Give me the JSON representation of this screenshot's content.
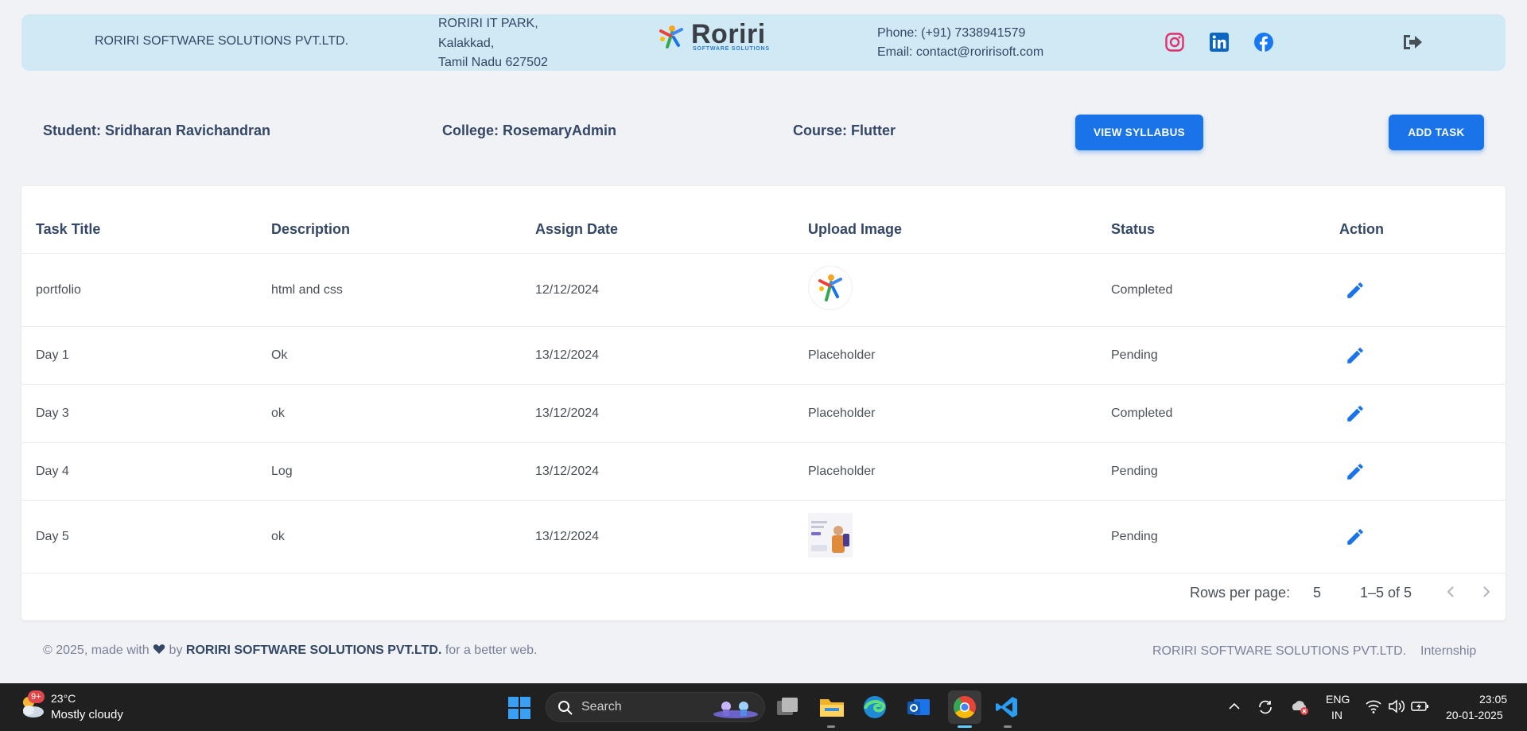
{
  "header": {
    "company_name": "RORIRI SOFTWARE SOLUTIONS PVT.LTD.",
    "address_line1": "RORIRI IT PARK,",
    "address_line2": "Kalakkad,",
    "address_line3": "Tamil Nadu 627502",
    "logo_name": "Roriri",
    "logo_tagline": "SOFTWARE SOLUTIONS",
    "phone": "Phone: (+91) 7338941579",
    "email": "Email: contact@roririsoft.com",
    "social_icons": [
      "instagram-icon",
      "linkedin-icon",
      "facebook-icon"
    ],
    "logout_icon": "logout-icon"
  },
  "info": {
    "student": "Student: Sridharan Ravichandran",
    "college": "College: RosemaryAdmin",
    "course": "Course: Flutter",
    "view_syllabus": "VIEW SYLLABUS",
    "add_task": "ADD TASK"
  },
  "table": {
    "columns": [
      "Task Title",
      "Description",
      "Assign Date",
      "Upload Image",
      "Status",
      "Action"
    ],
    "rows": [
      {
        "title": "portfolio",
        "description": "html and css",
        "date": "12/12/2024",
        "image": "roriri-logo",
        "status": "Completed"
      },
      {
        "title": "Day 1",
        "description": "Ok",
        "date": "13/12/2024",
        "image": "Placeholder",
        "status": "Pending"
      },
      {
        "title": "Day 3",
        "description": "ok",
        "date": "13/12/2024",
        "image": "Placeholder",
        "status": "Completed"
      },
      {
        "title": "Day 4",
        "description": "Log",
        "date": "13/12/2024",
        "image": "Placeholder",
        "status": "Pending"
      },
      {
        "title": "Day 5",
        "description": "ok",
        "date": "13/12/2024",
        "image": "screenshot-thumbnail",
        "status": "Pending"
      }
    ],
    "rows_per_page_label": "Rows per page:",
    "rows_per_page_value": "5",
    "range": "1–5 of 5"
  },
  "footer": {
    "copyright": "© 2025, made with",
    "by": "by",
    "company": "RORIRI SOFTWARE SOLUTIONS PVT.LTD.",
    "tail": "for a better web.",
    "link_company": "RORIRI SOFTWARE SOLUTIONS PVT.LTD.",
    "link_internship": "Internship"
  },
  "taskbar": {
    "weather_badge": "9+",
    "temperature": "23°C",
    "weather": "Mostly cloudy",
    "search_placeholder": "Search",
    "lang1": "ENG",
    "lang2": "IN",
    "time": "23:05",
    "date": "20-01-2025"
  },
  "colors": {
    "accent": "#1a73e8",
    "header_bg": "#cfe9f5",
    "page_bg": "#f0f2f5",
    "text": "#344767"
  }
}
